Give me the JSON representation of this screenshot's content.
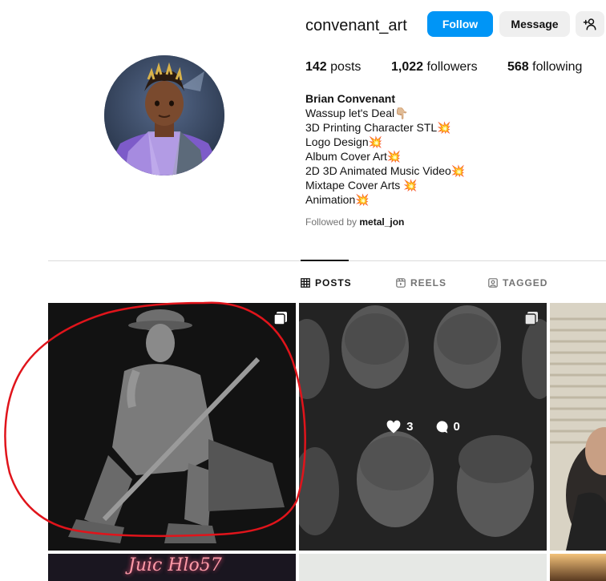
{
  "profile": {
    "username": "convenant_art",
    "follow_label": "Follow",
    "message_label": "Message",
    "stats": {
      "posts_count": "142",
      "posts_label": "posts",
      "followers_count": "1,022",
      "followers_label": "followers",
      "following_count": "568",
      "following_label": "following"
    },
    "bio": {
      "name": "Brian Convenant",
      "lines": [
        "Wassup let's Deal👇🏼",
        "3D Printing Character STL💥",
        "Logo Design💥",
        "Album Cover Art💥",
        "2D 3D Animated Music Video💥",
        "Mixtape Cover Arts 💥",
        "Animation💥"
      ]
    },
    "followed_by_prefix": "Followed by",
    "followed_by_user": "metal_jon"
  },
  "tabs": [
    {
      "label": "POSTS",
      "active": true
    },
    {
      "label": "REELS",
      "active": false
    },
    {
      "label": "TAGGED",
      "active": false
    }
  ],
  "posts": {
    "hovered_likes": "3",
    "hovered_comments": "0",
    "post4_text": "Juic Hlo57"
  },
  "colors": {
    "accent": "#0095f6",
    "annotation": "#e0141b"
  },
  "icons": [
    "add-person-icon",
    "grid-icon",
    "reels-icon",
    "tagged-icon",
    "multi-post-icon",
    "heart-icon",
    "comment-icon"
  ]
}
